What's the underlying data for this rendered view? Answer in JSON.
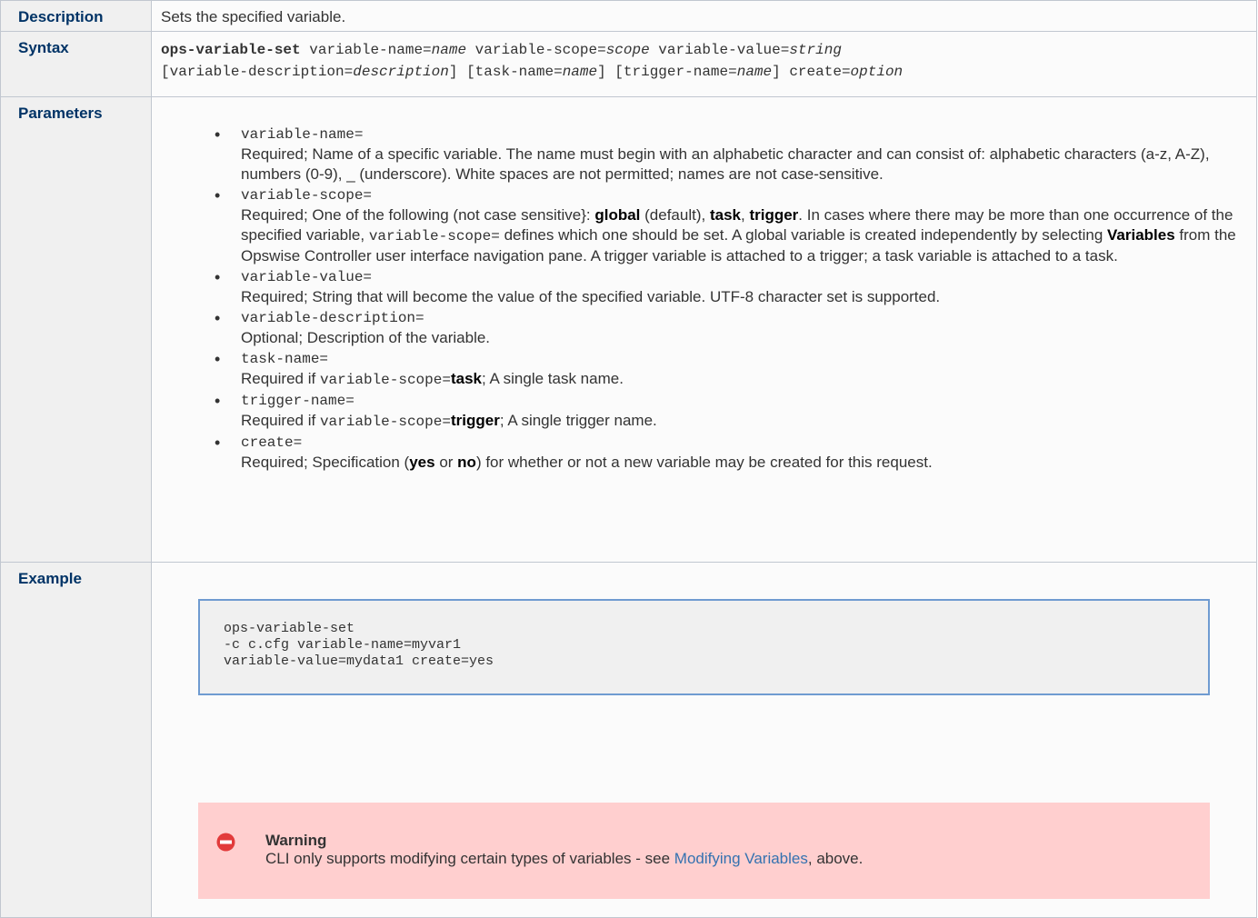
{
  "description": {
    "label": "Description",
    "text": "Sets the specified variable."
  },
  "syntax": {
    "label": "Syntax",
    "command": "ops-variable-set",
    "line1": [
      {
        "t": "variable-name=",
        "i": false
      },
      {
        "t": "name",
        "i": true
      },
      {
        "t": " variable-scope=",
        "i": false
      },
      {
        "t": "scope",
        "i": true
      },
      {
        "t": " variable-value=",
        "i": false
      },
      {
        "t": "string",
        "i": true
      }
    ],
    "line2": [
      {
        "t": "[variable-description=",
        "i": false
      },
      {
        "t": "description",
        "i": true
      },
      {
        "t": "] [task-name=",
        "i": false
      },
      {
        "t": "name",
        "i": true
      },
      {
        "t": "] [trigger-name=",
        "i": false
      },
      {
        "t": "name",
        "i": true
      },
      {
        "t": "] create=",
        "i": false
      },
      {
        "t": "option",
        "i": true
      }
    ]
  },
  "parameters": {
    "label": "Parameters",
    "items": [
      {
        "name": "variable-name=",
        "desc": [
          {
            "t": "Required; Name of a specific variable. The name must begin with an alphabetic character and can consist of: alphabetic characters (a-z, A-Z), numbers (0-9), _ (underscore). White spaces are not permitted; names are not case-sensitive.",
            "s": "n"
          }
        ]
      },
      {
        "name": "variable-scope=",
        "desc": [
          {
            "t": "Required; One of the following (not case sensitive}: ",
            "s": "n"
          },
          {
            "t": "global",
            "s": "b"
          },
          {
            "t": " (default), ",
            "s": "n"
          },
          {
            "t": "task",
            "s": "b"
          },
          {
            "t": ", ",
            "s": "n"
          },
          {
            "t": "trigger",
            "s": "b"
          },
          {
            "t": ". In cases where there may be more than one occurrence of the specified variable, ",
            "s": "n"
          },
          {
            "t": "variable-scope=",
            "s": "m"
          },
          {
            "t": " defines which one should be set. A global variable is created independently by selecting ",
            "s": "n"
          },
          {
            "t": "Variables",
            "s": "b"
          },
          {
            "t": " from the Opswise Controller user interface navigation pane. A trigger variable is attached to a trigger; a task variable is attached to a task.",
            "s": "n"
          }
        ]
      },
      {
        "name": "variable-value=",
        "desc": [
          {
            "t": "Required; String that will become the value of the specified variable. UTF-8 character set is supported.",
            "s": "n"
          }
        ]
      },
      {
        "name": "variable-description=",
        "desc": [
          {
            "t": "Optional; Description of the variable.",
            "s": "n"
          }
        ]
      },
      {
        "name": "task-name=",
        "desc": [
          {
            "t": "Required if ",
            "s": "n"
          },
          {
            "t": "variable-scope=",
            "s": "m"
          },
          {
            "t": "task",
            "s": "b"
          },
          {
            "t": "; A single task name.",
            "s": "n"
          }
        ]
      },
      {
        "name": "trigger-name=",
        "desc": [
          {
            "t": "Required if ",
            "s": "n"
          },
          {
            "t": "variable-scope=",
            "s": "m"
          },
          {
            "t": "trigger",
            "s": "b"
          },
          {
            "t": "; A single trigger name.",
            "s": "n"
          }
        ]
      },
      {
        "name": "create=",
        "desc": [
          {
            "t": "Required; Specification (",
            "s": "n"
          },
          {
            "t": "yes",
            "s": "b"
          },
          {
            "t": " or ",
            "s": "n"
          },
          {
            "t": "no",
            "s": "b"
          },
          {
            "t": ") for whether or not a new variable may be created for this request.",
            "s": "n"
          }
        ]
      }
    ]
  },
  "example": {
    "label": "Example",
    "code": "ops-variable-set\n-c c.cfg variable-name=myvar1\nvariable-value=mydata1 create=yes",
    "warning": {
      "icon": "no-entry-icon",
      "color": "#e23b3b",
      "title": "Warning",
      "text_before": "CLI only supports modifying certain types of variables - see ",
      "link_text": "Modifying Variables",
      "text_after": ", above."
    }
  }
}
